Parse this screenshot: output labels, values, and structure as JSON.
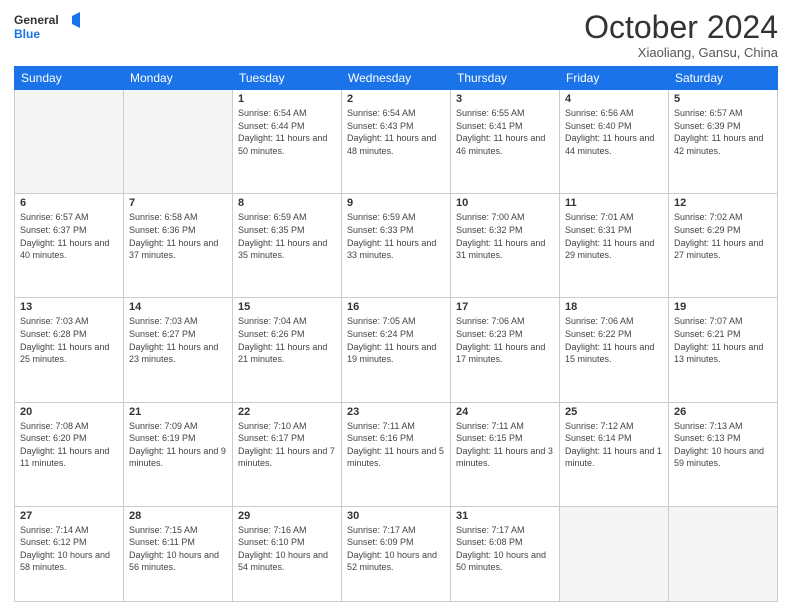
{
  "logo": {
    "line1": "General",
    "line2": "Blue"
  },
  "title": "October 2024",
  "location": "Xiaoliang, Gansu, China",
  "days_of_week": [
    "Sunday",
    "Monday",
    "Tuesday",
    "Wednesday",
    "Thursday",
    "Friday",
    "Saturday"
  ],
  "weeks": [
    [
      {
        "day": "",
        "content": ""
      },
      {
        "day": "",
        "content": ""
      },
      {
        "day": "1",
        "content": "Sunrise: 6:54 AM\nSunset: 6:44 PM\nDaylight: 11 hours and 50 minutes."
      },
      {
        "day": "2",
        "content": "Sunrise: 6:54 AM\nSunset: 6:43 PM\nDaylight: 11 hours and 48 minutes."
      },
      {
        "day": "3",
        "content": "Sunrise: 6:55 AM\nSunset: 6:41 PM\nDaylight: 11 hours and 46 minutes."
      },
      {
        "day": "4",
        "content": "Sunrise: 6:56 AM\nSunset: 6:40 PM\nDaylight: 11 hours and 44 minutes."
      },
      {
        "day": "5",
        "content": "Sunrise: 6:57 AM\nSunset: 6:39 PM\nDaylight: 11 hours and 42 minutes."
      }
    ],
    [
      {
        "day": "6",
        "content": "Sunrise: 6:57 AM\nSunset: 6:37 PM\nDaylight: 11 hours and 40 minutes."
      },
      {
        "day": "7",
        "content": "Sunrise: 6:58 AM\nSunset: 6:36 PM\nDaylight: 11 hours and 37 minutes."
      },
      {
        "day": "8",
        "content": "Sunrise: 6:59 AM\nSunset: 6:35 PM\nDaylight: 11 hours and 35 minutes."
      },
      {
        "day": "9",
        "content": "Sunrise: 6:59 AM\nSunset: 6:33 PM\nDaylight: 11 hours and 33 minutes."
      },
      {
        "day": "10",
        "content": "Sunrise: 7:00 AM\nSunset: 6:32 PM\nDaylight: 11 hours and 31 minutes."
      },
      {
        "day": "11",
        "content": "Sunrise: 7:01 AM\nSunset: 6:31 PM\nDaylight: 11 hours and 29 minutes."
      },
      {
        "day": "12",
        "content": "Sunrise: 7:02 AM\nSunset: 6:29 PM\nDaylight: 11 hours and 27 minutes."
      }
    ],
    [
      {
        "day": "13",
        "content": "Sunrise: 7:03 AM\nSunset: 6:28 PM\nDaylight: 11 hours and 25 minutes."
      },
      {
        "day": "14",
        "content": "Sunrise: 7:03 AM\nSunset: 6:27 PM\nDaylight: 11 hours and 23 minutes."
      },
      {
        "day": "15",
        "content": "Sunrise: 7:04 AM\nSunset: 6:26 PM\nDaylight: 11 hours and 21 minutes."
      },
      {
        "day": "16",
        "content": "Sunrise: 7:05 AM\nSunset: 6:24 PM\nDaylight: 11 hours and 19 minutes."
      },
      {
        "day": "17",
        "content": "Sunrise: 7:06 AM\nSunset: 6:23 PM\nDaylight: 11 hours and 17 minutes."
      },
      {
        "day": "18",
        "content": "Sunrise: 7:06 AM\nSunset: 6:22 PM\nDaylight: 11 hours and 15 minutes."
      },
      {
        "day": "19",
        "content": "Sunrise: 7:07 AM\nSunset: 6:21 PM\nDaylight: 11 hours and 13 minutes."
      }
    ],
    [
      {
        "day": "20",
        "content": "Sunrise: 7:08 AM\nSunset: 6:20 PM\nDaylight: 11 hours and 11 minutes."
      },
      {
        "day": "21",
        "content": "Sunrise: 7:09 AM\nSunset: 6:19 PM\nDaylight: 11 hours and 9 minutes."
      },
      {
        "day": "22",
        "content": "Sunrise: 7:10 AM\nSunset: 6:17 PM\nDaylight: 11 hours and 7 minutes."
      },
      {
        "day": "23",
        "content": "Sunrise: 7:11 AM\nSunset: 6:16 PM\nDaylight: 11 hours and 5 minutes."
      },
      {
        "day": "24",
        "content": "Sunrise: 7:11 AM\nSunset: 6:15 PM\nDaylight: 11 hours and 3 minutes."
      },
      {
        "day": "25",
        "content": "Sunrise: 7:12 AM\nSunset: 6:14 PM\nDaylight: 11 hours and 1 minute."
      },
      {
        "day": "26",
        "content": "Sunrise: 7:13 AM\nSunset: 6:13 PM\nDaylight: 10 hours and 59 minutes."
      }
    ],
    [
      {
        "day": "27",
        "content": "Sunrise: 7:14 AM\nSunset: 6:12 PM\nDaylight: 10 hours and 58 minutes."
      },
      {
        "day": "28",
        "content": "Sunrise: 7:15 AM\nSunset: 6:11 PM\nDaylight: 10 hours and 56 minutes."
      },
      {
        "day": "29",
        "content": "Sunrise: 7:16 AM\nSunset: 6:10 PM\nDaylight: 10 hours and 54 minutes."
      },
      {
        "day": "30",
        "content": "Sunrise: 7:17 AM\nSunset: 6:09 PM\nDaylight: 10 hours and 52 minutes."
      },
      {
        "day": "31",
        "content": "Sunrise: 7:17 AM\nSunset: 6:08 PM\nDaylight: 10 hours and 50 minutes."
      },
      {
        "day": "",
        "content": ""
      },
      {
        "day": "",
        "content": ""
      }
    ]
  ]
}
